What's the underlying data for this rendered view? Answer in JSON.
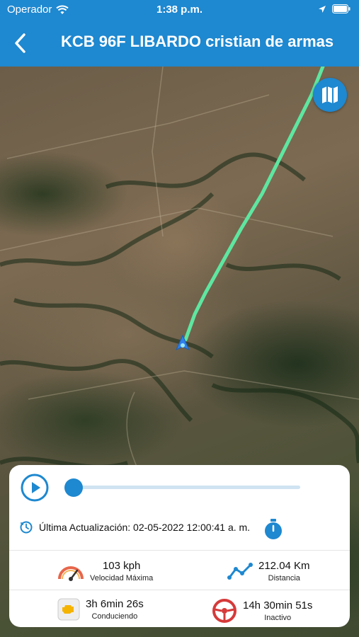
{
  "status_bar": {
    "carrier": "Operador",
    "time": "1:38 p.m."
  },
  "header": {
    "title": "KCB 96F LIBARDO cristian de armas",
    "back_icon": "chevron-left-icon"
  },
  "map": {
    "toggle_icon": "map-icon",
    "route_color": "#5ee6a0",
    "vehicle_marker_color": "#2f80ed"
  },
  "playback": {
    "play_icon": "play-icon",
    "progress": 0.0
  },
  "last_update": {
    "label": "Última Actualización: 02-05-2022 12:00:41 a. m."
  },
  "stats": {
    "max_speed": {
      "value": "103 kph",
      "label": "Velocidad Máxima",
      "icon": "speedometer-icon"
    },
    "distance": {
      "value": "212.04 Km",
      "label": "Distancia",
      "icon": "route-line-icon"
    },
    "driving": {
      "value": "3h 6min 26s",
      "label": "Conduciendo",
      "icon": "engine-icon"
    },
    "idle": {
      "value": "14h 30min 51s",
      "label": "Inactivo",
      "icon": "steering-wheel-icon"
    }
  },
  "colors": {
    "primary": "#1e88d0",
    "track": "#cfe3f2"
  }
}
